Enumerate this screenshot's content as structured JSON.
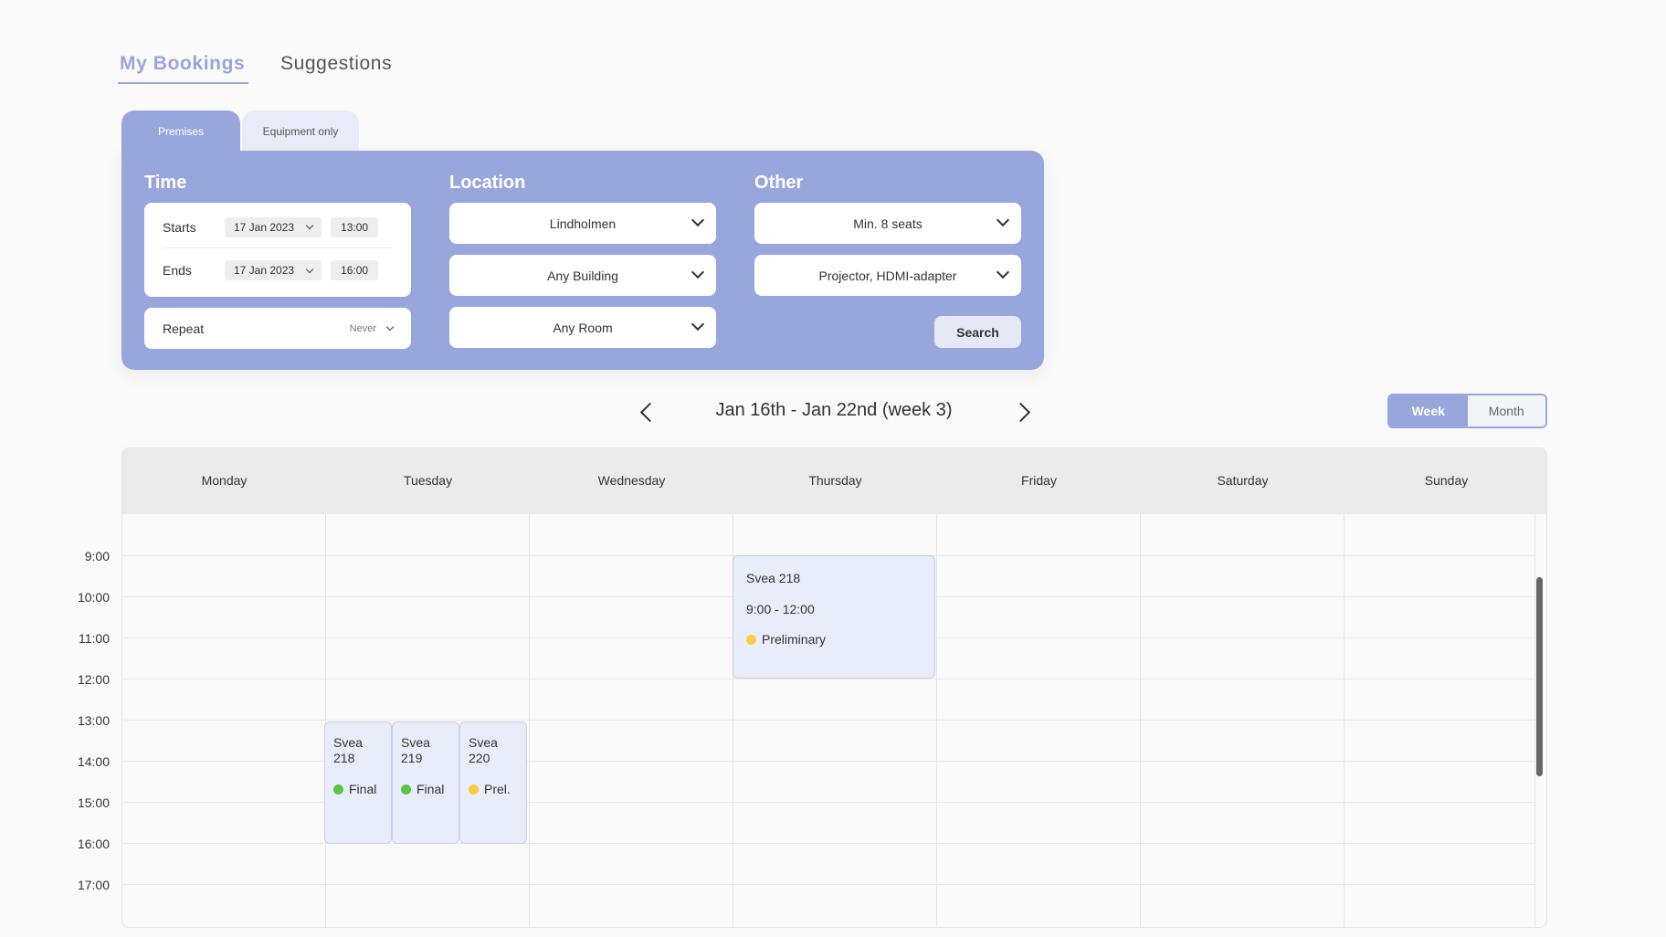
{
  "colors": {
    "accent": "#98a6db",
    "final": "#5cc34a",
    "preliminary": "#f5cf3f"
  },
  "top_tabs": [
    {
      "label": "My Bookings",
      "active": true
    },
    {
      "label": "Suggestions",
      "active": false
    }
  ],
  "search": {
    "sub_tabs": [
      {
        "label": "Premises",
        "active": true
      },
      {
        "label": "Equipment only",
        "active": false
      }
    ],
    "time": {
      "heading": "Time",
      "starts_label": "Starts",
      "starts_date": "17 Jan 2023",
      "starts_time": "13:00",
      "ends_label": "Ends",
      "ends_date": "17 Jan 2023",
      "ends_time": "16:00",
      "repeat_label": "Repeat",
      "repeat_value": "Never"
    },
    "location": {
      "heading": "Location",
      "area": "Lindholmen",
      "building": "Any Building",
      "room": "Any Room"
    },
    "other": {
      "heading": "Other",
      "seats": "Min. 8 seats",
      "equipment": "Projector, HDMI-adapter"
    },
    "search_button": "Search"
  },
  "calendar": {
    "range_label": "Jan 16th - Jan 22nd (week 3)",
    "view_toggle": {
      "week": "Week",
      "month": "Month",
      "selected": "Week"
    },
    "days": [
      "Monday",
      "Tuesday",
      "Wednesday",
      "Thursday",
      "Friday",
      "Saturday",
      "Sunday"
    ],
    "hours": [
      "9:00",
      "10:00",
      "11:00",
      "12:00",
      "13:00",
      "14:00",
      "15:00",
      "16:00",
      "17:00"
    ],
    "events": [
      {
        "room": "Svea 218",
        "time": "9:00 - 12:00",
        "status": "Preliminary",
        "status_type": "preliminary",
        "day": "Thursday"
      },
      {
        "room": "Svea 218",
        "status": "Final",
        "status_type": "final",
        "day": "Tuesday"
      },
      {
        "room": "Svea 219",
        "status": "Final",
        "status_type": "final",
        "day": "Tuesday"
      },
      {
        "room": "Svea 220",
        "status": "Prel.",
        "status_type": "preliminary",
        "day": "Tuesday"
      }
    ]
  }
}
